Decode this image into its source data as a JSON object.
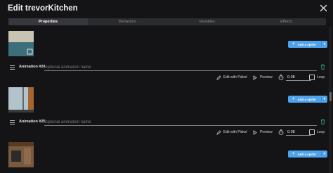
{
  "window": {
    "title": "Edit trevorKitchen"
  },
  "tabs": [
    {
      "label": "Properties"
    },
    {
      "label": "Behaviors"
    },
    {
      "label": "Variables"
    },
    {
      "label": "Effects"
    }
  ],
  "add_sprite": {
    "label": "Add a sprite"
  },
  "animation_name_placeholder": "Optional animation name",
  "toolbar": {
    "edit_label": "Edit with Piskel",
    "preview_label": "Preview",
    "loop_label": "Loop"
  },
  "animations": [
    {
      "label": "Animation #24",
      "name": "",
      "duration": "0.08",
      "loop": false
    },
    {
      "label": "Animation #25",
      "name": "",
      "duration": "0.08",
      "loop": false
    }
  ],
  "colors": {
    "accent": "#4ea3ec",
    "background": "#141416",
    "active_tab": "#37383d"
  }
}
